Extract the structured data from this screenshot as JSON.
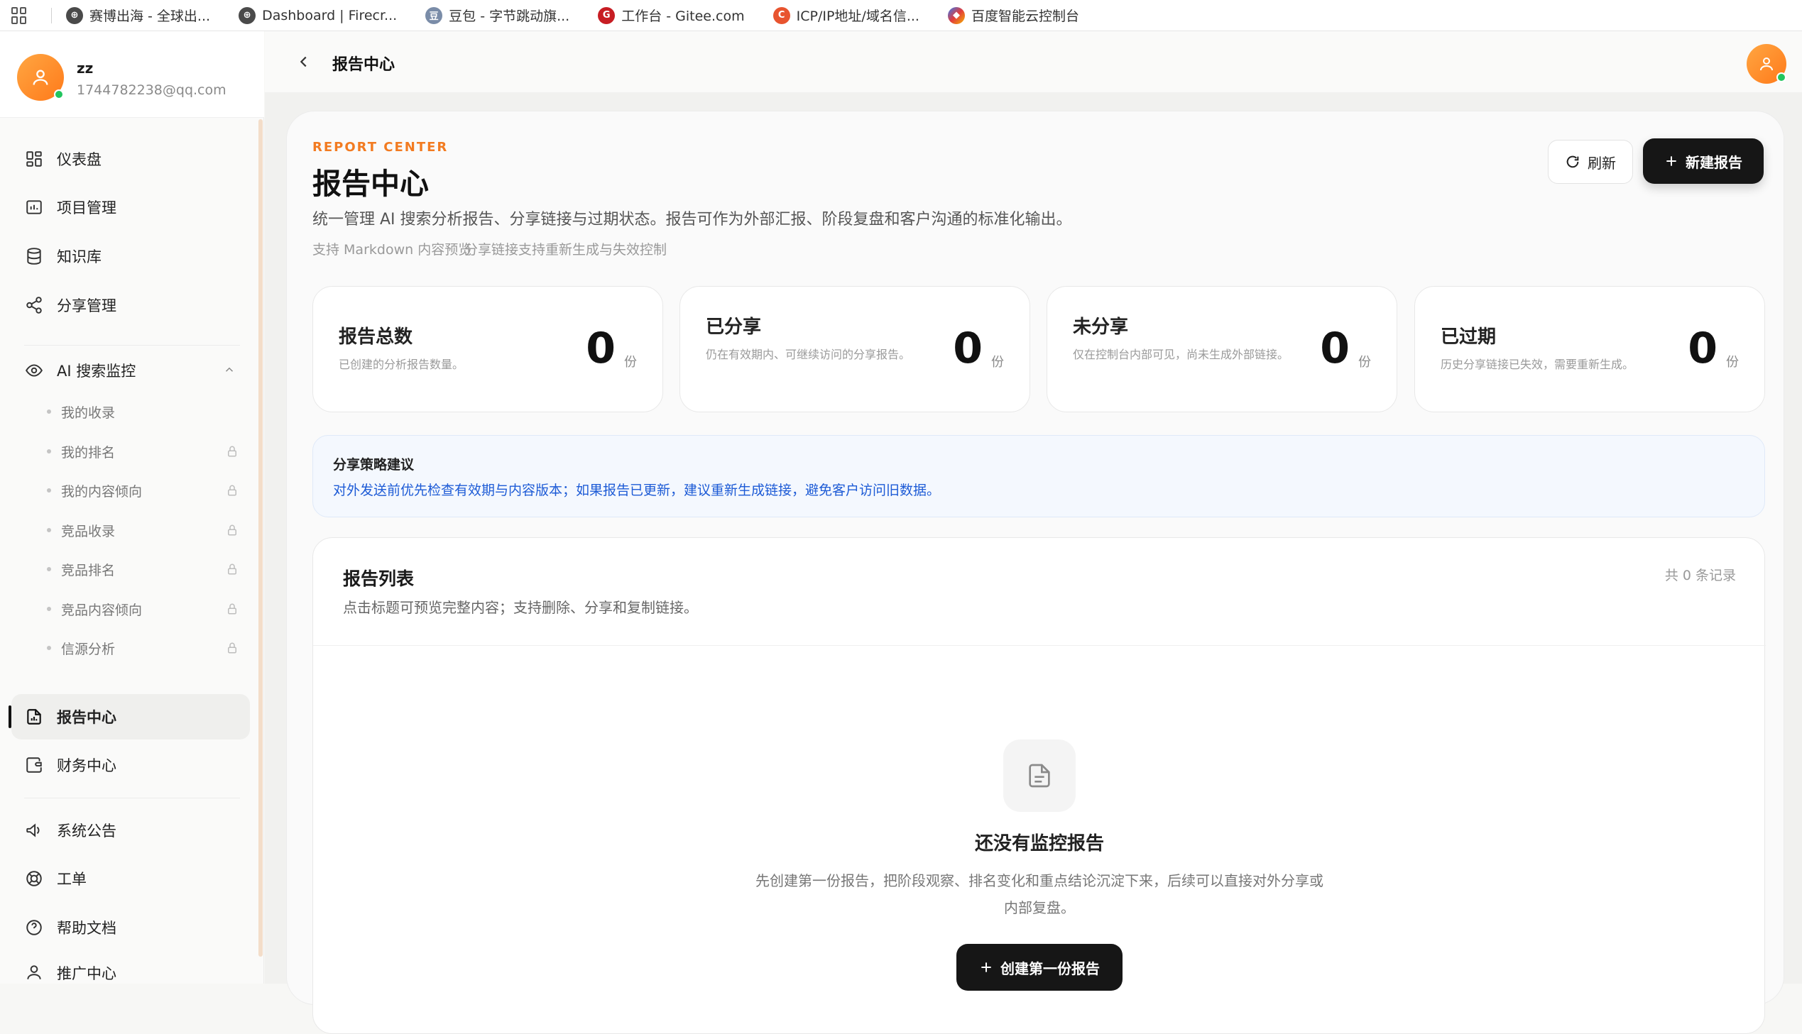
{
  "bookmarks": [
    {
      "label": "赛博出海 - 全球出...",
      "icon": "globe-icon"
    },
    {
      "label": "Dashboard | Firecr...",
      "icon": "globe-icon"
    },
    {
      "label": "豆包 - 字节跳动旗...",
      "icon": "doubao-icon"
    },
    {
      "label": "工作台 - Gitee.com",
      "icon": "gitee-icon"
    },
    {
      "label": "ICP/IP地址/域名信...",
      "icon": "icp-icon"
    },
    {
      "label": "百度智能云控制台",
      "icon": "baidu-cloud-icon"
    }
  ],
  "user": {
    "name": "zz",
    "email": "1744782238@qq.com"
  },
  "sidebar": {
    "items": [
      {
        "label": "仪表盘",
        "icon": "dashboard-icon"
      },
      {
        "label": "项目管理",
        "icon": "project-icon"
      },
      {
        "label": "知识库",
        "icon": "database-icon"
      },
      {
        "label": "分享管理",
        "icon": "share-icon"
      },
      {
        "label": "AI 搜索监控",
        "icon": "eye-icon"
      },
      {
        "label": "报告中心",
        "icon": "report-icon"
      },
      {
        "label": "财务中心",
        "icon": "wallet-icon"
      },
      {
        "label": "系统公告",
        "icon": "megaphone-icon"
      },
      {
        "label": "工单",
        "icon": "lifebuoy-icon"
      },
      {
        "label": "帮助文档",
        "icon": "help-icon"
      },
      {
        "label": "推广中心",
        "icon": "user-icon"
      }
    ],
    "sub_items": [
      {
        "label": "我的收录",
        "locked": false
      },
      {
        "label": "我的排名",
        "locked": true
      },
      {
        "label": "我的内容倾向",
        "locked": true
      },
      {
        "label": "竞品收录",
        "locked": true
      },
      {
        "label": "竞品排名",
        "locked": true
      },
      {
        "label": "竞品内容倾向",
        "locked": true
      },
      {
        "label": "信源分析",
        "locked": true
      }
    ]
  },
  "header": {
    "title": "报告中心"
  },
  "page": {
    "eyebrow": "REPORT CENTER",
    "title": "报告中心",
    "description": "统一管理 AI 搜索分析报告、分享链接与过期状态。报告可作为外部汇报、阶段复盘和客户沟通的标准化输出。",
    "hints": [
      "支持 Markdown 内容预览",
      "分享链接支持重新生成与失效控制"
    ],
    "refresh_label": "刷新",
    "new_label": "新建报告"
  },
  "stats": [
    {
      "title": "报告总数",
      "desc": "已创建的分析报告数量。",
      "value": "0",
      "unit": "份"
    },
    {
      "title": "已分享",
      "desc": "仍在有效期内、可继续访问的分享报告。",
      "value": "0",
      "unit": "份"
    },
    {
      "title": "未分享",
      "desc": "仅在控制台内部可见，尚未生成外部链接。",
      "value": "0",
      "unit": "份"
    },
    {
      "title": "已过期",
      "desc": "历史分享链接已失效，需要重新生成。",
      "value": "0",
      "unit": "份"
    }
  ],
  "tip": {
    "title": "分享策略建议",
    "text": "对外发送前优先检查有效期与内容版本；如果报告已更新，建议重新生成链接，避免客户访问旧数据。"
  },
  "list": {
    "title": "报告列表",
    "subtitle": "点击标题可预览完整内容；支持删除、分享和复制链接。",
    "count": "共 0 条记录",
    "empty_title": "还没有监控报告",
    "empty_desc": "先创建第一份报告，把阶段观察、排名变化和重点结论沉淀下来，后续可以直接对外分享或内部复盘。",
    "create_label": "创建第一份报告"
  },
  "colors": {
    "accent": "#f27b21",
    "tip_text": "#1d5bd6",
    "button_dark": "#161616"
  }
}
